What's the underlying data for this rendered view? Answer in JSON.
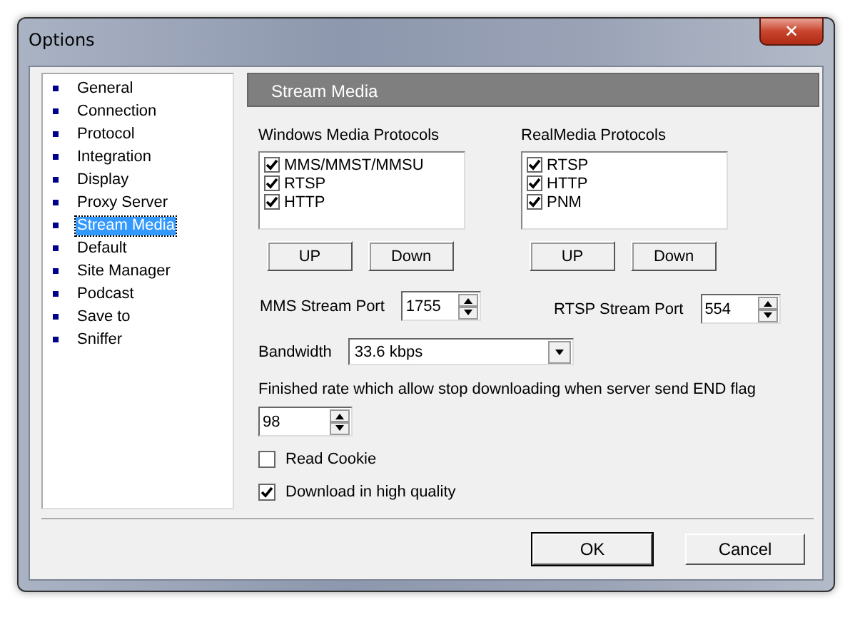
{
  "window": {
    "title": "Options",
    "close": "✕"
  },
  "sidebar": {
    "items": [
      {
        "label": "General",
        "selected": false
      },
      {
        "label": "Connection",
        "selected": false
      },
      {
        "label": "Protocol",
        "selected": false
      },
      {
        "label": "Integration",
        "selected": false
      },
      {
        "label": "Display",
        "selected": false
      },
      {
        "label": "Proxy Server",
        "selected": false
      },
      {
        "label": "Stream Media",
        "selected": true
      },
      {
        "label": "Default",
        "selected": false
      },
      {
        "label": "Site Manager",
        "selected": false
      },
      {
        "label": "Podcast",
        "selected": false
      },
      {
        "label": "Save to",
        "selected": false
      },
      {
        "label": "Sniffer",
        "selected": false
      }
    ]
  },
  "panel": {
    "title": "Stream Media"
  },
  "protocol_groups": [
    {
      "title": "Windows Media Protocols",
      "protocols": [
        {
          "label": "MMS/MMST/MMSU",
          "checked": true
        },
        {
          "label": "RTSP",
          "checked": true
        },
        {
          "label": "HTTP",
          "checked": true
        }
      ],
      "buttons": [
        "UP",
        "Down"
      ]
    },
    {
      "title": "RealMedia Protocols",
      "protocols": [
        {
          "label": "RTSP",
          "checked": true
        },
        {
          "label": "HTTP",
          "checked": true
        },
        {
          "label": "PNM",
          "checked": true
        }
      ],
      "buttons": [
        "UP",
        "Down"
      ]
    }
  ],
  "ports": [
    {
      "label": "MMS Stream Port",
      "value": "1755"
    },
    {
      "label": "RTSP Stream Port",
      "value": "554"
    }
  ],
  "bandwidth": {
    "label": "Bandwidth",
    "value": "33.6 kbps"
  },
  "finished_rate": {
    "label": "Finished rate which allow stop downloading when server send END flag",
    "value": "98"
  },
  "options": [
    {
      "label": "Read Cookie",
      "checked": false
    },
    {
      "label": "Download in high quality",
      "checked": true
    }
  ],
  "buttons": [
    {
      "label": "OK",
      "default": true
    },
    {
      "label": "Cancel",
      "default": false
    }
  ]
}
